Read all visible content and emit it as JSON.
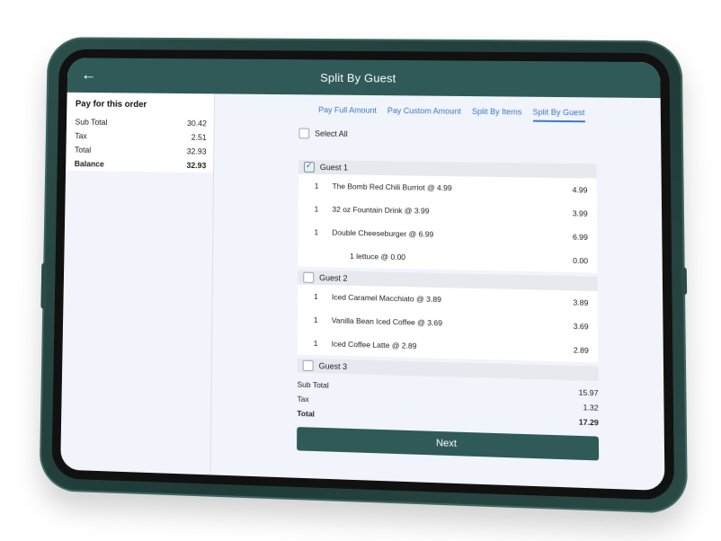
{
  "header": {
    "title": "Split By Guest",
    "back_icon": "arrow-left-icon"
  },
  "summary": {
    "title": "Pay for this order",
    "rows": [
      {
        "label": "Sub Total",
        "value": "30.42"
      },
      {
        "label": "Tax",
        "value": "2.51"
      },
      {
        "label": "Total",
        "value": "32.93"
      },
      {
        "label": "Balance",
        "value": "32.93"
      }
    ]
  },
  "tabs": [
    {
      "label": "Pay Full Amount"
    },
    {
      "label": "Pay Custom Amount"
    },
    {
      "label": "Split By Items"
    },
    {
      "label": "Split By Guest"
    }
  ],
  "select_all": {
    "label": "Select All"
  },
  "guests": [
    {
      "label": "Guest 1",
      "items": [
        {
          "qty": "1",
          "name": "The Bomb Red Chili Burriot @ 4.99",
          "price": "4.99"
        },
        {
          "qty": "1",
          "name": "32 oz Fountain Drink @ 3.99",
          "price": "3.99"
        },
        {
          "qty": "1",
          "name": "Double Cheeseburger @ 6.99",
          "price": "6.99"
        },
        {
          "qty": "",
          "name": "1 lettuce @ 0.00",
          "price": "0.00"
        }
      ]
    },
    {
      "label": "Guest 2",
      "items": [
        {
          "qty": "1",
          "name": "Iced Caramel Macchiato @ 3.89",
          "price": "3.89"
        },
        {
          "qty": "1",
          "name": "Vanilla Bean Iced Coffee @ 3.69",
          "price": "3.69"
        },
        {
          "qty": "1",
          "name": "Iced Coffee Latte @ 2.89",
          "price": "2.89"
        }
      ]
    },
    {
      "label": "Guest 3",
      "items": []
    }
  ],
  "totals": {
    "sub_total_label": "Sub Total",
    "sub_total": "15.97",
    "tax_label": "Tax",
    "tax": "1.32",
    "total_label": "Total",
    "total": "17.29"
  },
  "next_button": {
    "label": "Next"
  }
}
